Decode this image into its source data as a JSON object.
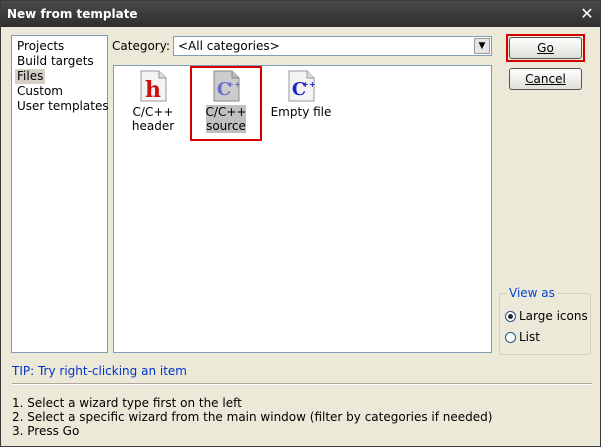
{
  "window": {
    "title": "New from template",
    "close_icon": "close-icon"
  },
  "left_list": {
    "items": [
      {
        "label": "Projects"
      },
      {
        "label": "Build targets"
      },
      {
        "label": "Files"
      },
      {
        "label": "Custom"
      },
      {
        "label": "User templates"
      }
    ],
    "selected": "Files"
  },
  "category": {
    "label": "Category:",
    "value": "<All categories>"
  },
  "wizards": [
    {
      "line1": "C/C++",
      "line2": "header",
      "icon": "h-header-file-icon"
    },
    {
      "line1": "C/C++",
      "line2": "source",
      "icon": "cpp-source-file-icon",
      "selected": true
    },
    {
      "line1": "Empty file",
      "line2": "",
      "icon": "empty-file-icon"
    }
  ],
  "buttons": {
    "go": "Go",
    "cancel": "Cancel"
  },
  "view_as": {
    "label": "View as",
    "large_icons": "Large icons",
    "list": "List",
    "selected": "Large icons"
  },
  "tip": "TIP: Try right-clicking an item",
  "instructions": [
    "1. Select a wizard type first on the left",
    "2. Select a specific wizard from the main window (filter by categories if needed)",
    "3. Press Go"
  ],
  "colors": {
    "highlight": "#d40000",
    "tip": "#0033cc",
    "group_label": "#0046d5"
  }
}
